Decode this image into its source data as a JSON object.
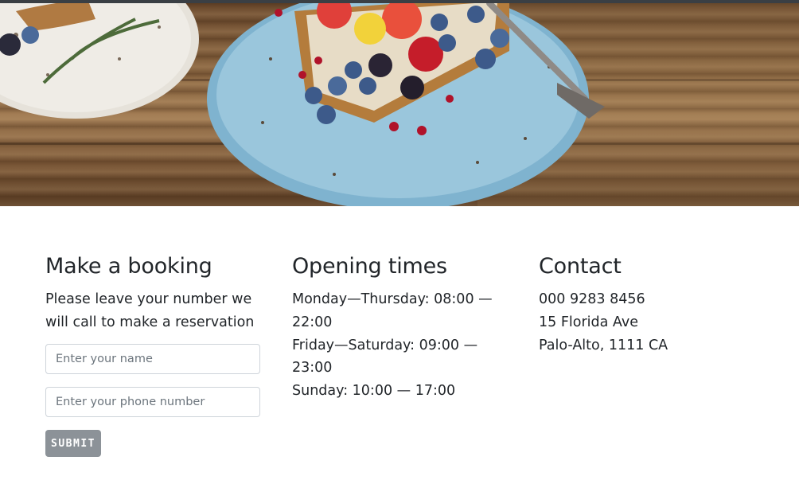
{
  "hero": {
    "image_icon": "breakfast-toast-plate-photo"
  },
  "booking": {
    "title": "Make a booking",
    "description": "Please leave your number we will call to make a reservation",
    "name_placeholder": "Enter your name",
    "phone_placeholder": "Enter your phone number",
    "submit_label": "SUBMIT"
  },
  "hours": {
    "title": "Opening times",
    "line1": "Monday—Thursday: 08:00 —",
    "line2": "22:00",
    "line3": "Friday—Saturday: 09:00 —",
    "line4": "23:00",
    "line5": "Sunday: 10:00 — 17:00"
  },
  "contact": {
    "title": "Contact",
    "phone": "000 9283 8456",
    "street": "15 Florida Ave",
    "city": "Palo-Alto, 1111 CA"
  },
  "colors": {
    "button": "#8c9298",
    "text": "#212529",
    "border": "#ced4da"
  }
}
